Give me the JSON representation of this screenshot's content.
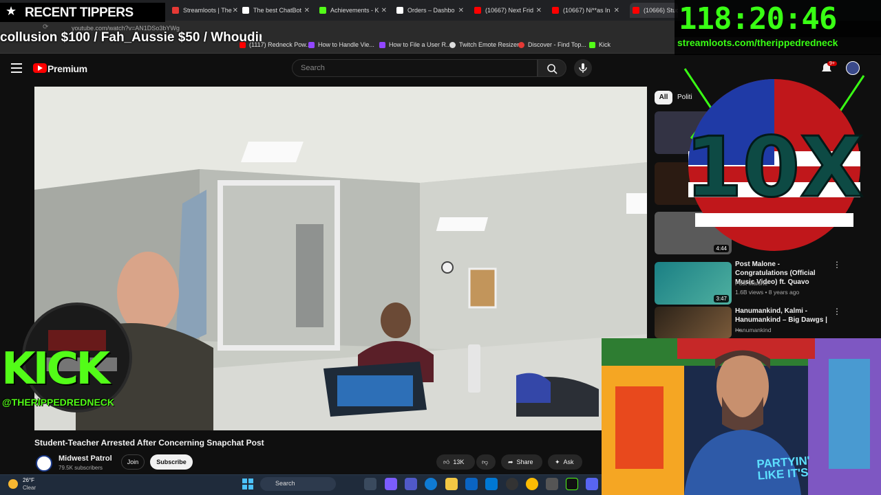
{
  "browser": {
    "tabs": [
      {
        "label": "Streamloots | The",
        "color": "#e53935"
      },
      {
        "label": "The best ChatBot",
        "color": "#ffffff"
      },
      {
        "label": "Achievements - K",
        "color": "#53fc18"
      },
      {
        "label": "Orders – Dashbo",
        "color": "#ffffff"
      },
      {
        "label": "(10667) Next Frid",
        "color": "#ff0000"
      },
      {
        "label": "(10667) Ni**as In",
        "color": "#ff0000"
      },
      {
        "label": "(10666) Stude",
        "color": "#ff0000"
      }
    ],
    "url": "youtube.com/watch?v=AN1DSo3bYWg",
    "bookmarks": [
      {
        "label": "(1117) Redneck Pow...",
        "color": "#ff0000"
      },
      {
        "label": "How to Handle Vie...",
        "color": "#9146ff"
      },
      {
        "label": "How to File a User R...",
        "color": "#9146ff"
      },
      {
        "label": "Twitch Emote Resizer",
        "color": "#dddddd"
      },
      {
        "label": "Discover - Find Top...",
        "color": "#e53935"
      },
      {
        "label": "Kick",
        "color": "#53fc18"
      }
    ]
  },
  "overlay": {
    "tippers_title": "RECENT TIPPERS",
    "ticker": "collusion $100 / Fah_Aussie $50 / Whoudini $50 /",
    "timer": "118:20:46",
    "timer_url": "streamloots.com/therippedredneck",
    "badge_text": "10X",
    "kick_text": "KICK",
    "kick_handle": "@THERIPPEDREDNECK",
    "shirt_text_1": "PARTYIN'",
    "shirt_text_2": "LIKE IT'S"
  },
  "youtube": {
    "brand": "Premium",
    "search_placeholder": "Search",
    "notif_count": "9+",
    "chips": [
      "All",
      "Politi"
    ],
    "video": {
      "title": "Student-Teacher Arrested After Concerning Snapchat Post",
      "channel": "Midwest Patrol",
      "subscribers": "79.5K subscribers",
      "join_label": "Join",
      "subscribe_label": "Subscribe",
      "likes": "13K",
      "share_label": "Share",
      "ask_label": "Ask"
    },
    "recommendations": [
      {
        "title": "Post Malone - Congratulations (Official Music Video) ft. Quavo",
        "channel": "Post Malone",
        "meta": "1.6B views • 8 years ago",
        "duration": "3:47"
      },
      {
        "title": "Hanumankind, Kalmi - Hanumankind – Big Dawgs | ...",
        "channel": "Hanumankind",
        "meta": "",
        "duration": ""
      }
    ],
    "hidden_durations": [
      "4:44"
    ]
  },
  "taskbar": {
    "temp": "26°F",
    "condition": "Clear",
    "search_label": "Search"
  }
}
